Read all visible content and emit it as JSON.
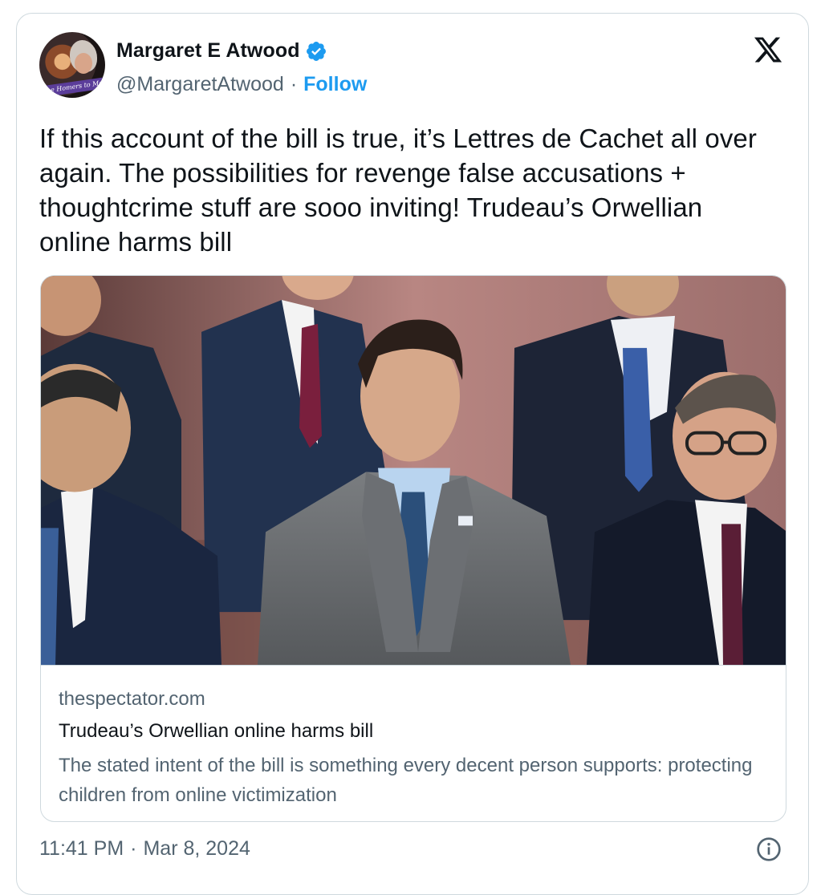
{
  "author": {
    "display_name": "Margaret E Atwood",
    "handle": "@MargaretAtwood",
    "separator": "·",
    "follow_label": "Follow",
    "avatar_banner": "e Homers to Me"
  },
  "tweet": {
    "text": "If this account of the bill is true, it’s Lettres de Cachet all over again. The possibilities for revenge false accusations + thoughtcrime stuff are sooo inviting! Trudeau’s Orwellian online harms bill"
  },
  "link_card": {
    "domain": "thespectator.com",
    "title": "Trudeau’s Orwellian online harms bill",
    "description": "The stated intent of the bill is something every decent person supports: protecting children from online victimization"
  },
  "footer": {
    "time": "11:41 PM",
    "separator": "·",
    "date": "Mar 8, 2024"
  },
  "icons": {
    "verified": "verified-badge-icon",
    "platform": "x-logo-icon",
    "info": "info-icon"
  },
  "colors": {
    "accent": "#1d9bf0",
    "secondary_text": "#536471",
    "border": "#cfd9de"
  }
}
